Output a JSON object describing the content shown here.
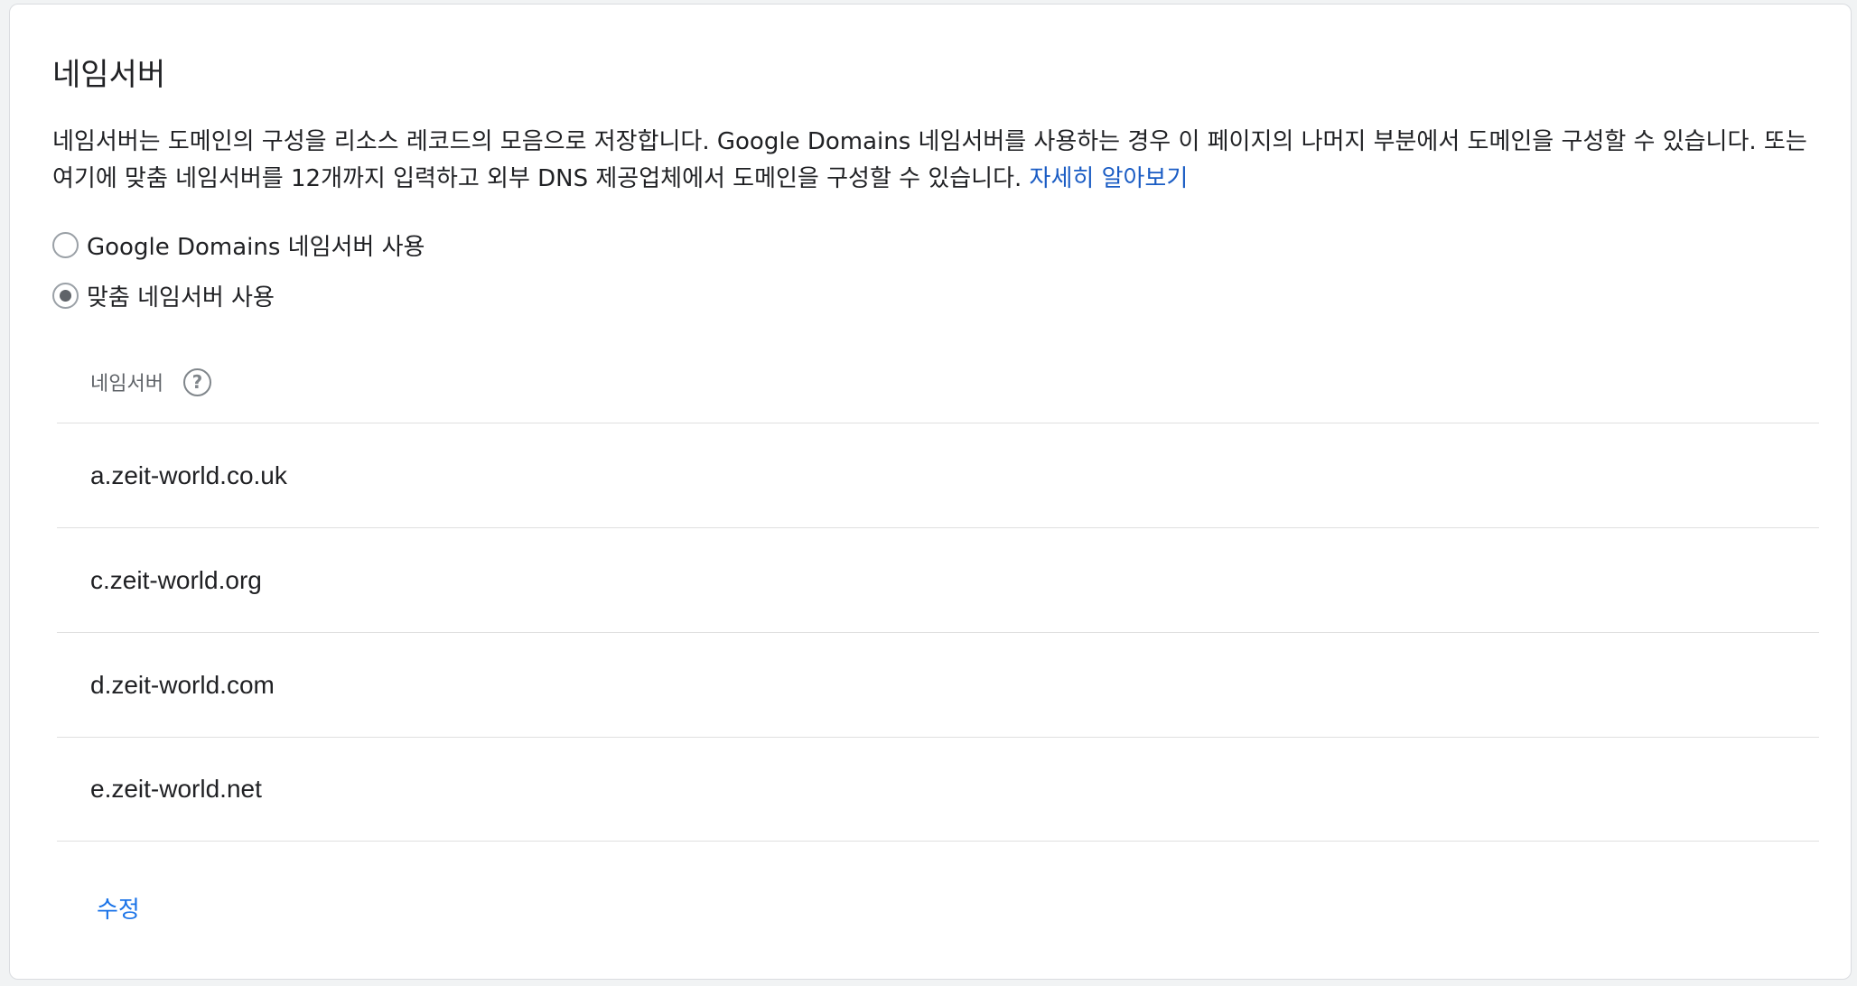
{
  "section": {
    "title": "네임서버",
    "description": "네임서버는 도메인의 구성을 리소스 레코드의 모음으로 저장합니다. Google Domains 네임서버를 사용하는 경우 이 페이지의 나머지 부분에서 도메인을 구성할 수 있습니다. 또는 여기에 맞춤 네임서버를 12개까지 입력하고 외부 DNS 제공업체에서 도메인을 구성할 수 있습니다. ",
    "learn_more_link": "자세히 알아보기"
  },
  "options": {
    "google": {
      "label": "Google Domains 네임서버 사용",
      "selected": false
    },
    "custom": {
      "label": "맞춤 네임서버 사용",
      "selected": true
    }
  },
  "table": {
    "header": "네임서버",
    "help_icon": "help-circle-icon",
    "rows": [
      "a.zeit-world.co.uk",
      "c.zeit-world.org",
      "d.zeit-world.com",
      "e.zeit-world.net"
    ]
  },
  "actions": {
    "edit_label": "수정"
  },
  "colors": {
    "link": "#1a5cc4",
    "action": "#1a73e8",
    "divider": "#e0e0e0"
  }
}
